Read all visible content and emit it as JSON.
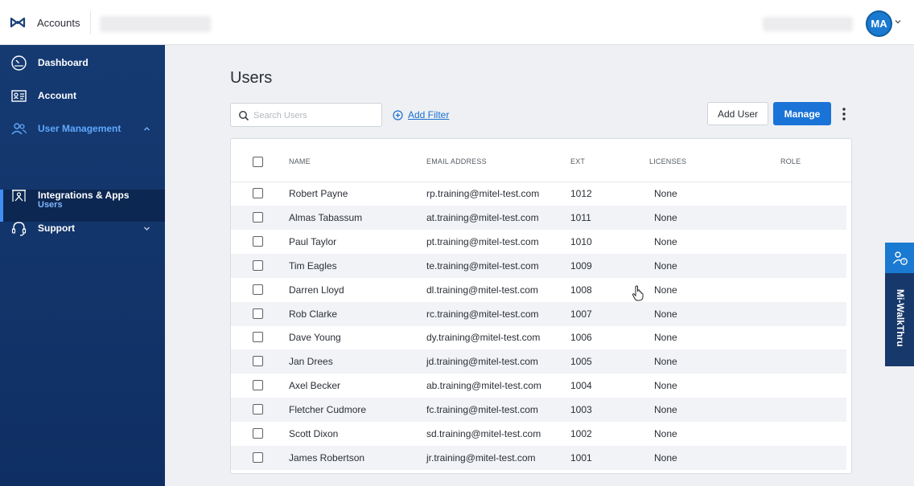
{
  "header": {
    "app_title": "Accounts",
    "avatar_initials": "MA"
  },
  "sidebar": {
    "items": [
      {
        "label": "Dashboard",
        "icon": "dashboard-icon"
      },
      {
        "label": "Account",
        "icon": "account-card-icon"
      },
      {
        "label": "User Management",
        "icon": "users-icon",
        "expanded": true
      },
      {
        "label": "Integrations & Apps",
        "icon": "integrations-icon"
      },
      {
        "label": "Support",
        "icon": "support-headset-icon"
      }
    ],
    "sub_items": [
      {
        "label": "Users",
        "active": true
      }
    ]
  },
  "main": {
    "title": "Users",
    "search_placeholder": "Search Users",
    "add_filter_label": "Add Filter",
    "add_user_label": "Add User",
    "manage_label": "Manage"
  },
  "table": {
    "columns": [
      "NAME",
      "EMAIL ADDRESS",
      "EXT",
      "LICENSES",
      "ROLE"
    ],
    "rows": [
      {
        "name": "Robert Payne",
        "email": "rp.training@mitel-test.com",
        "ext": "1012",
        "licenses": "None",
        "role": ""
      },
      {
        "name": "Almas Tabassum",
        "email": "at.training@mitel-test.com",
        "ext": "1011",
        "licenses": "None",
        "role": ""
      },
      {
        "name": "Paul Taylor",
        "email": "pt.training@mitel-test.com",
        "ext": "1010",
        "licenses": "None",
        "role": ""
      },
      {
        "name": "Tim Eagles",
        "email": "te.training@mitel-test.com",
        "ext": "1009",
        "licenses": "None",
        "role": ""
      },
      {
        "name": "Darren Lloyd",
        "email": "dl.training@mitel-test.com",
        "ext": "1008",
        "licenses": "None",
        "role": ""
      },
      {
        "name": "Rob Clarke",
        "email": "rc.training@mitel-test.com",
        "ext": "1007",
        "licenses": "None",
        "role": ""
      },
      {
        "name": "Dave Young",
        "email": "dy.training@mitel-test.com",
        "ext": "1006",
        "licenses": "None",
        "role": ""
      },
      {
        "name": "Jan Drees",
        "email": "jd.training@mitel-test.com",
        "ext": "1005",
        "licenses": "None",
        "role": ""
      },
      {
        "name": "Axel Becker",
        "email": "ab.training@mitel-test.com",
        "ext": "1004",
        "licenses": "None",
        "role": ""
      },
      {
        "name": "Fletcher Cudmore",
        "email": "fc.training@mitel-test.com",
        "ext": "1003",
        "licenses": "None",
        "role": ""
      },
      {
        "name": "Scott Dixon",
        "email": "sd.training@mitel-test.com",
        "ext": "1002",
        "licenses": "None",
        "role": ""
      },
      {
        "name": "James Robertson",
        "email": "jr.training@mitel-test.com",
        "ext": "1001",
        "licenses": "None",
        "role": ""
      }
    ]
  },
  "walkthru": {
    "label": "Mi-WalkThru"
  },
  "colors": {
    "sidebar": "#153a72",
    "primary": "#1a73d6",
    "link": "#1a6fd1",
    "avatar": "#1a7ad1"
  }
}
